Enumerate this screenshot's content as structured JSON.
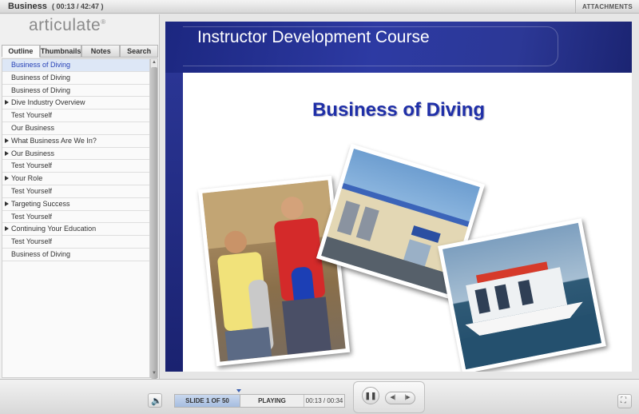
{
  "window": {
    "title": "Business",
    "time": "( 00:13 / 42:47 )",
    "attachments_label": "ATTACHMENTS"
  },
  "sidebar": {
    "logo": "articulate",
    "logo_mark": "®",
    "tabs": [
      {
        "label": "Outline",
        "active": true
      },
      {
        "label": "Thumbnails"
      },
      {
        "label": "Notes"
      },
      {
        "label": "Search"
      }
    ],
    "outline": [
      {
        "label": "Business of Diving",
        "expandable": false,
        "selected": true
      },
      {
        "label": "Business of Diving",
        "expandable": false
      },
      {
        "label": "Business of Diving",
        "expandable": false
      },
      {
        "label": "Dive Industry Overview",
        "expandable": true
      },
      {
        "label": "Test Yourself",
        "expandable": false
      },
      {
        "label": "Our Business",
        "expandable": false
      },
      {
        "label": "What Business Are We In?",
        "expandable": true
      },
      {
        "label": "Our Business",
        "expandable": true
      },
      {
        "label": "Test Yourself",
        "expandable": false
      },
      {
        "label": "Your Role",
        "expandable": true
      },
      {
        "label": "Test Yourself",
        "expandable": false
      },
      {
        "label": "Targeting Success",
        "expandable": true
      },
      {
        "label": "Test Yourself",
        "expandable": false
      },
      {
        "label": "Continuing Your Education",
        "expandable": true
      },
      {
        "label": "Test Yourself",
        "expandable": false
      },
      {
        "label": "Business of Diving",
        "expandable": false
      }
    ]
  },
  "slide": {
    "course_title": "Instructor Development Course",
    "slide_title": "Business of Diving"
  },
  "player": {
    "slide_label": "SLIDE 1 OF 50",
    "status": "PLAYING",
    "time": "00:13 / 00:34",
    "progress": 0.38
  },
  "icons": {
    "volume": "speaker-icon",
    "pause": "pause-icon",
    "prev": "prev-icon",
    "next": "next-icon",
    "fullscreen": "fullscreen-icon"
  }
}
